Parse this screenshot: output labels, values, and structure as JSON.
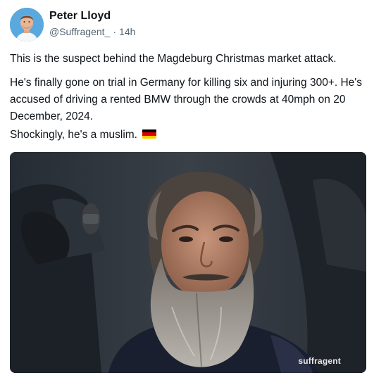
{
  "post": {
    "author": {
      "name": "Peter Lloyd",
      "handle": "@Suffragent_",
      "separator": "·",
      "time": "14h",
      "avatar_icon": "profile-avatar"
    },
    "paragraphs": [
      "This is the suspect behind the Magdeburg Christmas market attack.",
      "He's finally gone on trial in Germany for killing six and injuring 300+. He's accused of driving a rented BMW through the crowds at 40mph on 20 December, 2024.",
      "Shockingly, he's a muslim."
    ],
    "flag_icon": "germany-flag",
    "flag_colors": [
      "#000000",
      "#dd0000",
      "#ffce00"
    ],
    "media": {
      "watermark": "suffragent",
      "image_icon": "photo-bearded-man-in-court"
    }
  },
  "colors": {
    "text": "#0f1419",
    "secondary_text": "#536471",
    "avatar_bg": "#5aa9de"
  }
}
